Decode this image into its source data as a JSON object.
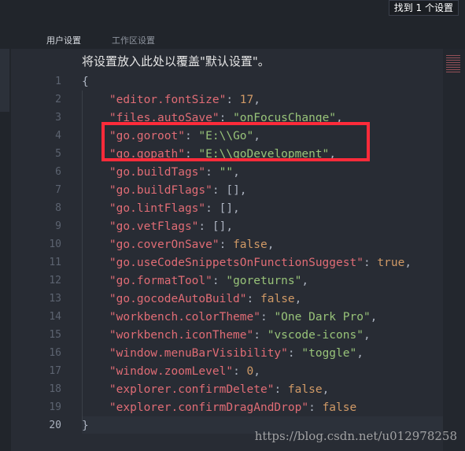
{
  "topbar": {
    "found_label": "找到 1 个设置"
  },
  "tabs": [
    {
      "label": "用户设置",
      "active": true
    },
    {
      "label": "工作区设置",
      "active": false
    }
  ],
  "header": {
    "text": "将设置放入此处以覆盖\"默认设置\"。"
  },
  "line_numbers": [
    "1",
    "2",
    "3",
    "4",
    "5",
    "6",
    "7",
    "8",
    "9",
    "10",
    "11",
    "12",
    "13",
    "14",
    "15",
    "16",
    "17",
    "18",
    "19",
    "20"
  ],
  "active_line": "20",
  "lines": [
    {
      "parts": [
        {
          "t": "{",
          "c": "punct"
        }
      ]
    },
    {
      "parts": [
        {
          "t": "    ",
          "c": "punct"
        },
        {
          "t": "\"editor.fontSize\"",
          "c": "key"
        },
        {
          "t": ": ",
          "c": "punct"
        },
        {
          "t": "17",
          "c": "num"
        },
        {
          "t": ",",
          "c": "punct"
        }
      ]
    },
    {
      "parts": [
        {
          "t": "    ",
          "c": "punct"
        },
        {
          "t": "\"files.autoSave\"",
          "c": "key"
        },
        {
          "t": ": ",
          "c": "punct"
        },
        {
          "t": "\"onFocusChange\"",
          "c": "str"
        },
        {
          "t": ",",
          "c": "punct"
        }
      ]
    },
    {
      "parts": [
        {
          "t": "    ",
          "c": "punct"
        },
        {
          "t": "\"go.goroot\"",
          "c": "key"
        },
        {
          "t": ": ",
          "c": "punct"
        },
        {
          "t": "\"E:\\\\Go\"",
          "c": "str"
        },
        {
          "t": ",",
          "c": "punct"
        }
      ]
    },
    {
      "parts": [
        {
          "t": "    ",
          "c": "punct"
        },
        {
          "t": "\"go.gopath\"",
          "c": "key"
        },
        {
          "t": ": ",
          "c": "punct"
        },
        {
          "t": "\"E:\\\\goDevelopment\"",
          "c": "str"
        },
        {
          "t": ",",
          "c": "punct"
        }
      ]
    },
    {
      "parts": [
        {
          "t": "    ",
          "c": "punct"
        },
        {
          "t": "\"go.buildTags\"",
          "c": "key"
        },
        {
          "t": ": ",
          "c": "punct"
        },
        {
          "t": "\"\"",
          "c": "str"
        },
        {
          "t": ",",
          "c": "punct"
        }
      ]
    },
    {
      "parts": [
        {
          "t": "    ",
          "c": "punct"
        },
        {
          "t": "\"go.buildFlags\"",
          "c": "key"
        },
        {
          "t": ": [],",
          "c": "punct"
        }
      ]
    },
    {
      "parts": [
        {
          "t": "    ",
          "c": "punct"
        },
        {
          "t": "\"go.lintFlags\"",
          "c": "key"
        },
        {
          "t": ": [],",
          "c": "punct"
        }
      ]
    },
    {
      "parts": [
        {
          "t": "    ",
          "c": "punct"
        },
        {
          "t": "\"go.vetFlags\"",
          "c": "key"
        },
        {
          "t": ": [],",
          "c": "punct"
        }
      ]
    },
    {
      "parts": [
        {
          "t": "    ",
          "c": "punct"
        },
        {
          "t": "\"go.coverOnSave\"",
          "c": "key"
        },
        {
          "t": ": ",
          "c": "punct"
        },
        {
          "t": "false",
          "c": "kw"
        },
        {
          "t": ",",
          "c": "punct"
        }
      ]
    },
    {
      "parts": [
        {
          "t": "    ",
          "c": "punct"
        },
        {
          "t": "\"go.useCodeSnippetsOnFunctionSuggest\"",
          "c": "key"
        },
        {
          "t": ": ",
          "c": "punct"
        },
        {
          "t": "true",
          "c": "kw"
        },
        {
          "t": ",",
          "c": "punct"
        }
      ]
    },
    {
      "parts": [
        {
          "t": "    ",
          "c": "punct"
        },
        {
          "t": "\"go.formatTool\"",
          "c": "key"
        },
        {
          "t": ": ",
          "c": "punct"
        },
        {
          "t": "\"goreturns\"",
          "c": "str"
        },
        {
          "t": ",",
          "c": "punct"
        }
      ]
    },
    {
      "parts": [
        {
          "t": "    ",
          "c": "punct"
        },
        {
          "t": "\"go.gocodeAutoBuild\"",
          "c": "key"
        },
        {
          "t": ": ",
          "c": "punct"
        },
        {
          "t": "false",
          "c": "kw"
        },
        {
          "t": ",",
          "c": "punct"
        }
      ]
    },
    {
      "parts": [
        {
          "t": "    ",
          "c": "punct"
        },
        {
          "t": "\"workbench.colorTheme\"",
          "c": "key"
        },
        {
          "t": ": ",
          "c": "punct"
        },
        {
          "t": "\"One Dark Pro\"",
          "c": "str"
        },
        {
          "t": ",",
          "c": "punct"
        }
      ]
    },
    {
      "parts": [
        {
          "t": "    ",
          "c": "punct"
        },
        {
          "t": "\"workbench.iconTheme\"",
          "c": "key"
        },
        {
          "t": ": ",
          "c": "punct"
        },
        {
          "t": "\"vscode-icons\"",
          "c": "str"
        },
        {
          "t": ",",
          "c": "punct"
        }
      ]
    },
    {
      "parts": [
        {
          "t": "    ",
          "c": "punct"
        },
        {
          "t": "\"window.menuBarVisibility\"",
          "c": "key"
        },
        {
          "t": ": ",
          "c": "punct"
        },
        {
          "t": "\"toggle\"",
          "c": "str"
        },
        {
          "t": ",",
          "c": "punct"
        }
      ]
    },
    {
      "parts": [
        {
          "t": "    ",
          "c": "punct"
        },
        {
          "t": "\"window.zoomLevel\"",
          "c": "key"
        },
        {
          "t": ": ",
          "c": "punct"
        },
        {
          "t": "0",
          "c": "num"
        },
        {
          "t": ",",
          "c": "punct"
        }
      ]
    },
    {
      "parts": [
        {
          "t": "    ",
          "c": "punct"
        },
        {
          "t": "\"explorer.confirmDelete\"",
          "c": "key"
        },
        {
          "t": ": ",
          "c": "punct"
        },
        {
          "t": "false",
          "c": "kw"
        },
        {
          "t": ",",
          "c": "punct"
        }
      ]
    },
    {
      "parts": [
        {
          "t": "    ",
          "c": "punct"
        },
        {
          "t": "\"explorer.confirmDragAndDrop\"",
          "c": "key"
        },
        {
          "t": ": ",
          "c": "punct"
        },
        {
          "t": "false",
          "c": "kw"
        }
      ]
    },
    {
      "parts": [
        {
          "t": "}",
          "c": "punct"
        }
      ]
    }
  ],
  "highlight_color": "#ff2b3a",
  "watermark": "https://blog.csdn.net/u012978258"
}
